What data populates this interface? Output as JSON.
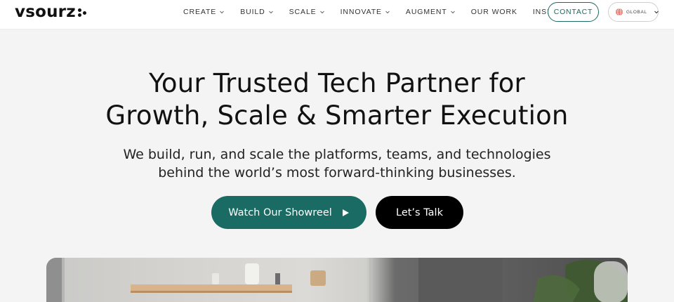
{
  "header": {
    "logo_text": "vsourz",
    "nav": [
      {
        "label": "CREATE",
        "has_dropdown": true
      },
      {
        "label": "BUILD",
        "has_dropdown": true
      },
      {
        "label": "SCALE",
        "has_dropdown": true
      },
      {
        "label": "INNOVATE",
        "has_dropdown": true
      },
      {
        "label": "AUGMENT",
        "has_dropdown": true
      },
      {
        "label": "OUR WORK",
        "has_dropdown": false
      },
      {
        "label": "INSIGHTS",
        "has_dropdown": false
      }
    ],
    "contact_label": "CONTACT",
    "region_label": "GLOBAL"
  },
  "hero": {
    "title_line1": "Your Trusted Tech Partner for",
    "title_line2": "Growth, Scale & Smarter Execution",
    "subtitle_line1": "We build, run, and scale the platforms, teams, and technologies",
    "subtitle_line2": "behind the world’s most forward-thinking businesses.",
    "primary_button": "Watch Our Showreel",
    "secondary_button": "Let’s Talk"
  },
  "colors": {
    "accent": "#1a6b63",
    "background": "#f4f4f4",
    "dark_button": "#000000"
  },
  "icons": {
    "logo_mark": "dots-icon",
    "dropdown": "chevron-down-icon",
    "region": "globe-icon",
    "play": "play-icon"
  }
}
